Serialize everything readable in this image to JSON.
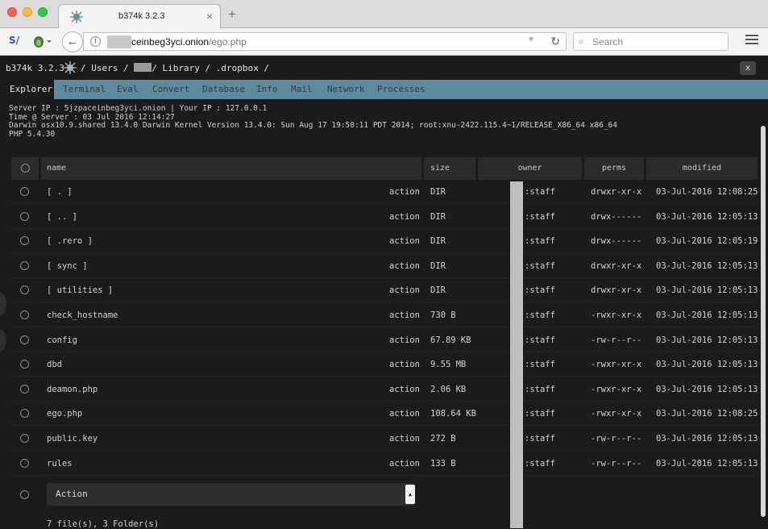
{
  "browser": {
    "tab_title": "b374k 3.2.3",
    "tab_close": "×",
    "new_tab": "+",
    "url_host": "ceinbeg3yci.onion",
    "url_path": "/ego.php",
    "search_placeholder": "Search"
  },
  "app": {
    "name": "b374k 3.2.3",
    "breadcrumb": [
      "/",
      "Users",
      "/",
      "/",
      "Library",
      "/",
      ".dropbox",
      "/"
    ],
    "close_label": "x"
  },
  "tabs": [
    "Explorer",
    "Terminal",
    "Eval",
    "Convert",
    "Database",
    "Info",
    "Mail",
    "Network",
    "Processes"
  ],
  "active_tab": "Explorer",
  "sysinfo": {
    "line1": "Server IP : 5jzpaceinbeg3yci.onion | Your IP : 127.0.0.1",
    "line2": "Time @ Server : 03 Jul 2016 12:14:27",
    "line3": "Darwin osx10.9.shared 13.4.0 Darwin Kernel Version 13.4.0: Sun Aug 17 19:50:11 PDT 2014; root:xnu-2422.115.4~1/RELEASE_X86_64 x86_64",
    "line4": "PHP 5.4.30"
  },
  "table": {
    "headers": {
      "name": "name",
      "size": "size",
      "owner": "owner",
      "perms": "perms",
      "modified": "modified"
    },
    "rows": [
      {
        "name": "[ . ]",
        "action": "action",
        "size": "DIR",
        "owner": ":staff",
        "perms": "drwxr-xr-x",
        "modified": "03-Jul-2016 12:08:25"
      },
      {
        "name": "[ .. ]",
        "action": "action",
        "size": "DIR",
        "owner": ":staff",
        "perms": "drwx------",
        "modified": "03-Jul-2016 12:05:13"
      },
      {
        "name": "[ .rero ]",
        "action": "action",
        "size": "DIR",
        "owner": ":staff",
        "perms": "drwx------",
        "modified": "03-Jul-2016 12:05:19"
      },
      {
        "name": "[ sync ]",
        "action": "action",
        "size": "DIR",
        "owner": ":staff",
        "perms": "drwxr-xr-x",
        "modified": "03-Jul-2016 12:05:13"
      },
      {
        "name": "[ utilities ]",
        "action": "action",
        "size": "DIR",
        "owner": ":staff",
        "perms": "drwxr-xr-x",
        "modified": "03-Jul-2016 12:05:13"
      },
      {
        "name": "check_hostname",
        "action": "action",
        "size": "730 B",
        "owner": ":staff",
        "perms": "-rwxr-xr-x",
        "modified": "03-Jul-2016 12:05:13"
      },
      {
        "name": "config",
        "action": "action",
        "size": "67.89 KB",
        "owner": ":staff",
        "perms": "-rw-r--r--",
        "modified": "03-Jul-2016 12:05:13"
      },
      {
        "name": "dbd",
        "action": "action",
        "size": "9.55 MB",
        "owner": ":staff",
        "perms": "-rwxr-xr-x",
        "modified": "03-Jul-2016 12:05:13"
      },
      {
        "name": "deamon.php",
        "action": "action",
        "size": "2.06 KB",
        "owner": ":staff",
        "perms": "-rwxr-xr-x",
        "modified": "03-Jul-2016 12:05:13"
      },
      {
        "name": "ego.php",
        "action": "action",
        "size": "108.64 KB",
        "owner": ":staff",
        "perms": "-rwxr-xr-x",
        "modified": "03-Jul-2016 12:08:25"
      },
      {
        "name": "public.key",
        "action": "action",
        "size": "272 B",
        "owner": ":staff",
        "perms": "-rw-r--r--",
        "modified": "03-Jul-2016 12:05:13"
      },
      {
        "name": "rules",
        "action": "action",
        "size": "133 B",
        "owner": ":staff",
        "perms": "-rw-r--r--",
        "modified": "03-Jul-2016 12:05:13"
      }
    ]
  },
  "action_select": {
    "label": "Action"
  },
  "summary": "7 file(s), 3 Folder(s)",
  "colors": {
    "menu_bg": "#5e8a9c",
    "page_bg": "#1b1b1b",
    "header_bg": "#2b2b2b"
  }
}
